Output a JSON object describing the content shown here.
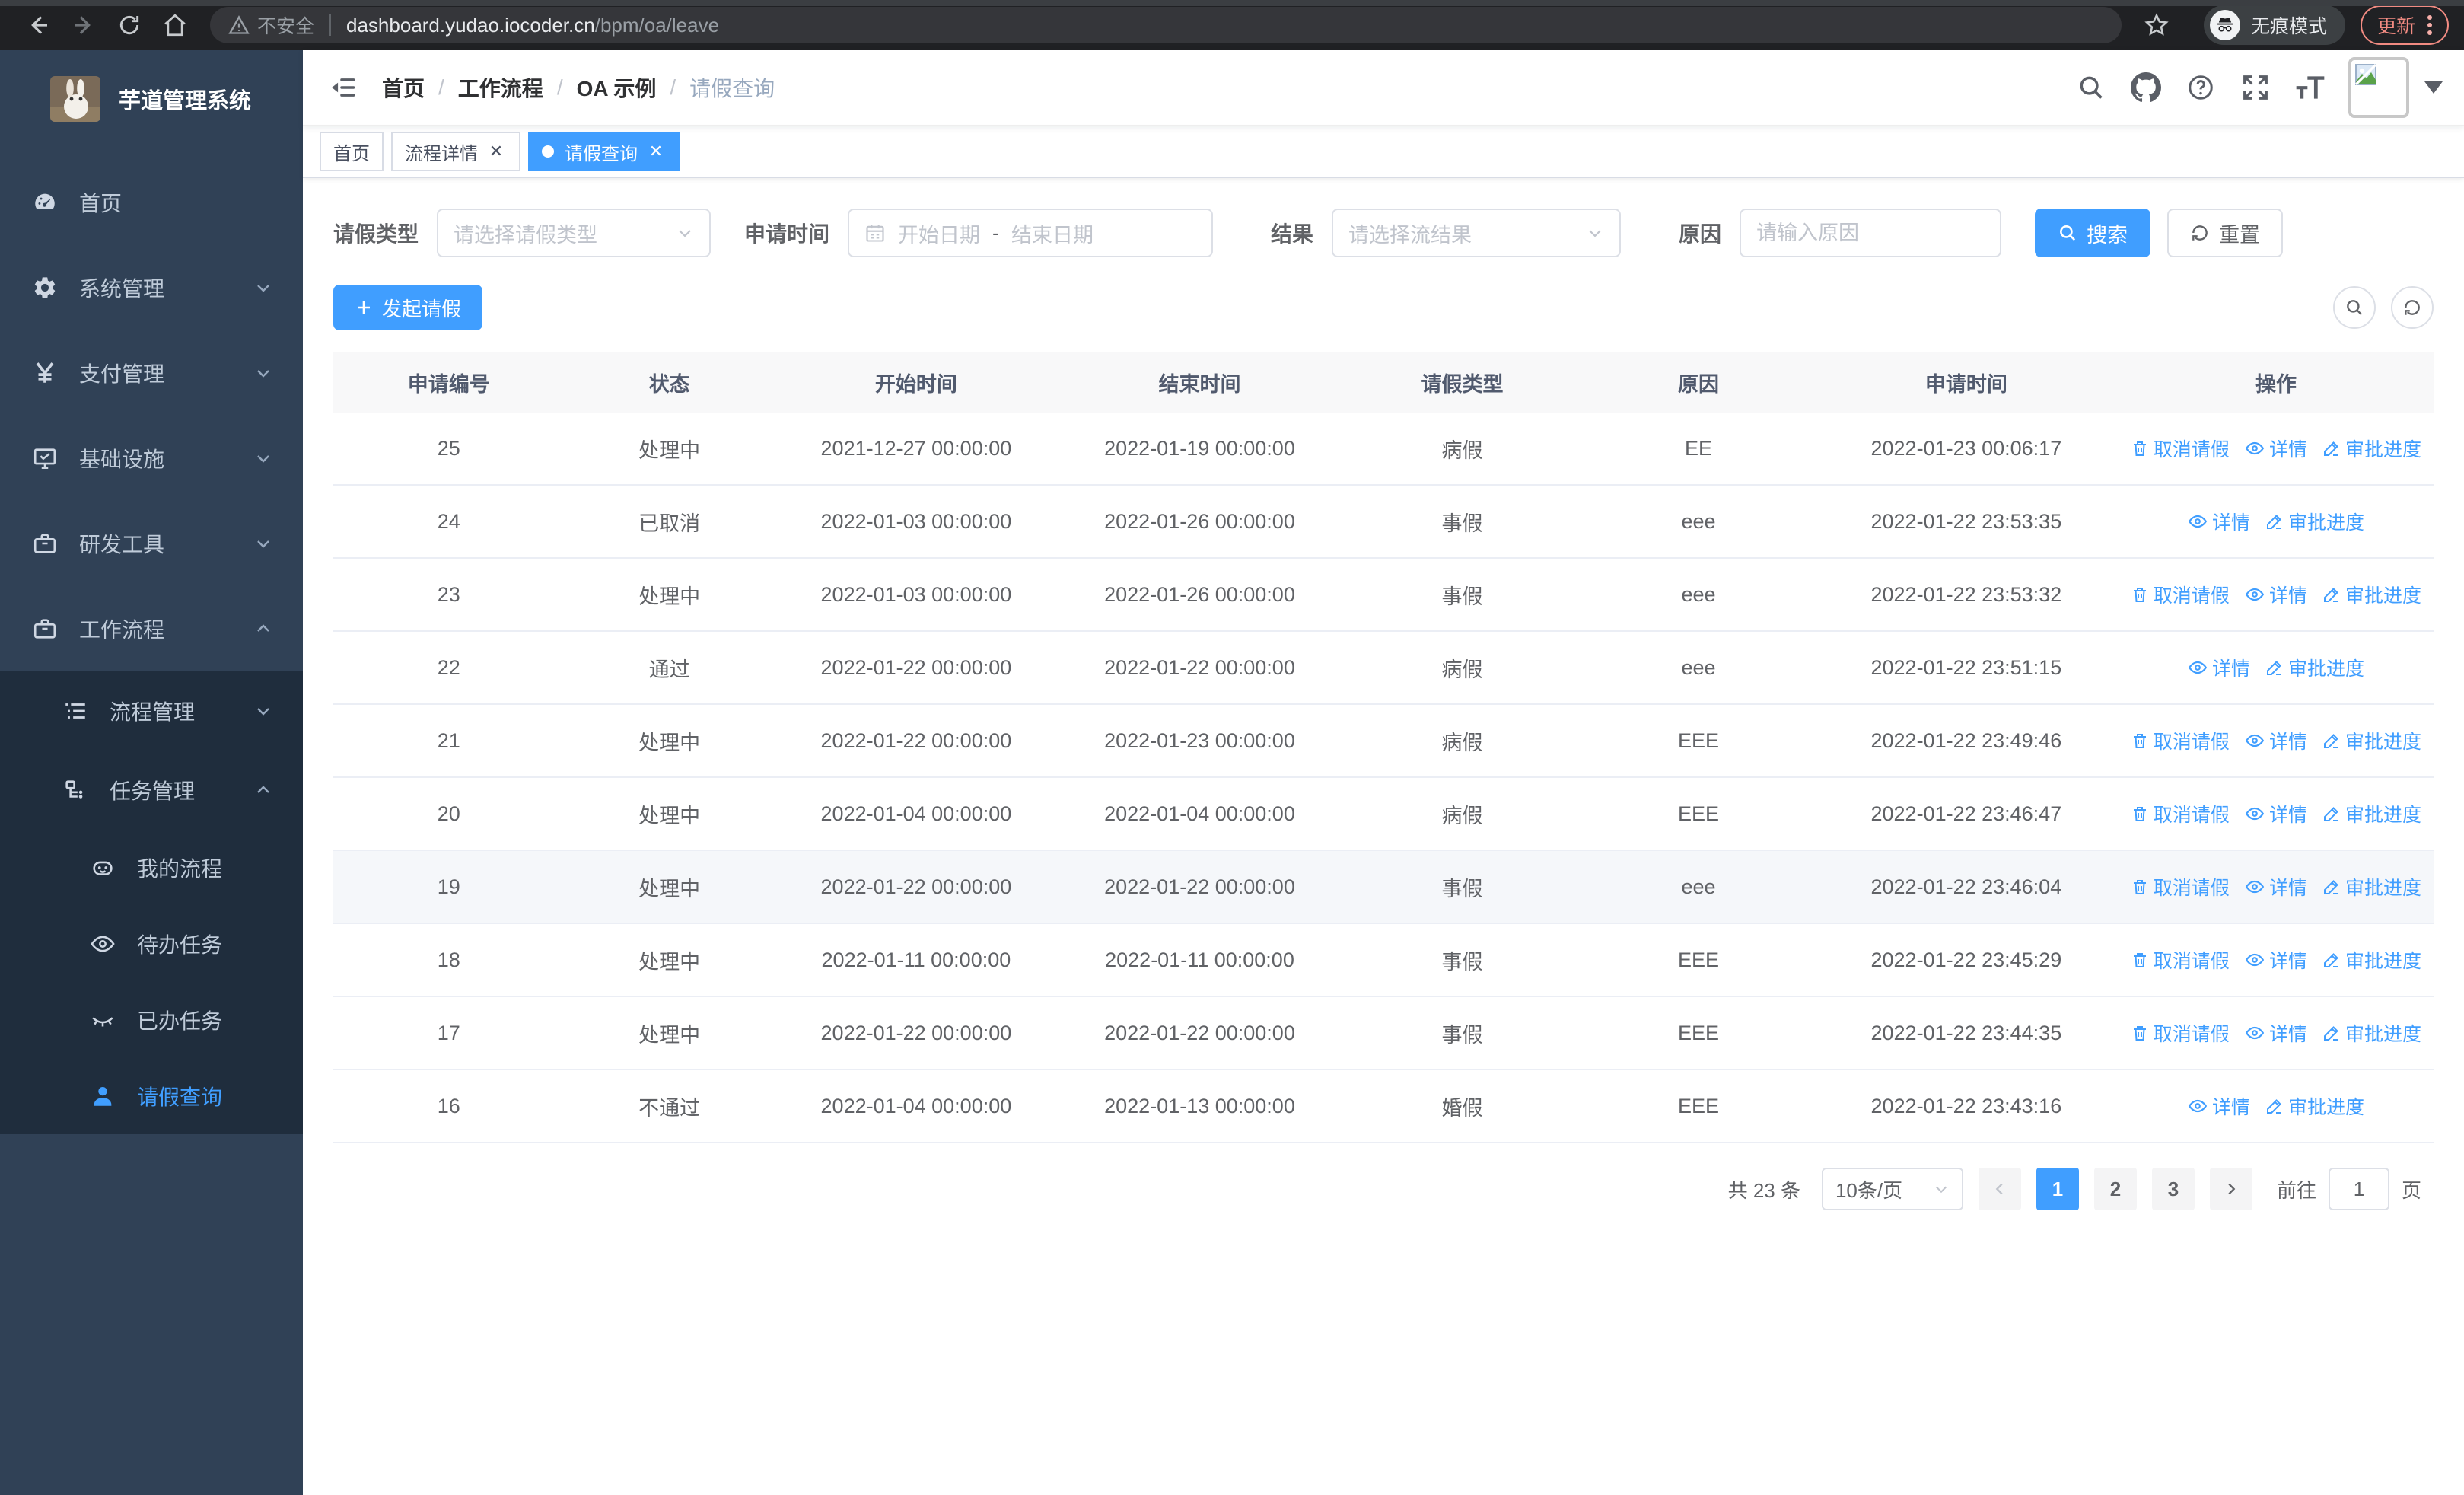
{
  "browser": {
    "security_label": "不安全",
    "url_host": "dashboard.yudao.iocoder.cn",
    "url_path": "/bpm/oa/leave",
    "incognito_label": "无痕模式",
    "update_label": "更新"
  },
  "sidebar": {
    "title": "芋道管理系统",
    "items": [
      {
        "label": "首页"
      },
      {
        "label": "系统管理"
      },
      {
        "label": "支付管理"
      },
      {
        "label": "基础设施"
      },
      {
        "label": "研发工具"
      },
      {
        "label": "工作流程"
      },
      {
        "label": "流程管理"
      },
      {
        "label": "任务管理"
      },
      {
        "label": "我的流程"
      },
      {
        "label": "待办任务"
      },
      {
        "label": "已办任务"
      },
      {
        "label": "请假查询"
      }
    ]
  },
  "breadcrumb": {
    "items": [
      "首页",
      "工作流程",
      "OA 示例",
      "请假查询"
    ]
  },
  "tabs": [
    {
      "label": "首页"
    },
    {
      "label": "流程详情"
    },
    {
      "label": "请假查询"
    }
  ],
  "filters": {
    "leave_type_label": "请假类型",
    "leave_type_placeholder": "请选择请假类型",
    "apply_time_label": "申请时间",
    "start_date_placeholder": "开始日期",
    "range_separator": "-",
    "end_date_placeholder": "结束日期",
    "result_label": "结果",
    "result_placeholder": "请选择流结果",
    "reason_label": "原因",
    "reason_placeholder": "请输入原因",
    "search_label": "搜索",
    "reset_label": "重置"
  },
  "toolbar": {
    "create_label": "发起请假"
  },
  "table": {
    "columns": [
      "申请编号",
      "状态",
      "开始时间",
      "结束时间",
      "请假类型",
      "原因",
      "申请时间",
      "操作"
    ],
    "actions": {
      "cancel": "取消请假",
      "detail": "详情",
      "progress": "审批进度"
    },
    "rows": [
      {
        "id": "25",
        "status": "处理中",
        "start": "2021-12-27 00:00:00",
        "end": "2022-01-19 00:00:00",
        "type": "病假",
        "reason": "EE",
        "applied": "2022-01-23 00:06:17",
        "can_cancel": true,
        "highlight": false
      },
      {
        "id": "24",
        "status": "已取消",
        "start": "2022-01-03 00:00:00",
        "end": "2022-01-26 00:00:00",
        "type": "事假",
        "reason": "eee",
        "applied": "2022-01-22 23:53:35",
        "can_cancel": false,
        "highlight": false
      },
      {
        "id": "23",
        "status": "处理中",
        "start": "2022-01-03 00:00:00",
        "end": "2022-01-26 00:00:00",
        "type": "事假",
        "reason": "eee",
        "applied": "2022-01-22 23:53:32",
        "can_cancel": true,
        "highlight": false
      },
      {
        "id": "22",
        "status": "通过",
        "start": "2022-01-22 00:00:00",
        "end": "2022-01-22 00:00:00",
        "type": "病假",
        "reason": "eee",
        "applied": "2022-01-22 23:51:15",
        "can_cancel": false,
        "highlight": false
      },
      {
        "id": "21",
        "status": "处理中",
        "start": "2022-01-22 00:00:00",
        "end": "2022-01-23 00:00:00",
        "type": "病假",
        "reason": "EEE",
        "applied": "2022-01-22 23:49:46",
        "can_cancel": true,
        "highlight": false
      },
      {
        "id": "20",
        "status": "处理中",
        "start": "2022-01-04 00:00:00",
        "end": "2022-01-04 00:00:00",
        "type": "病假",
        "reason": "EEE",
        "applied": "2022-01-22 23:46:47",
        "can_cancel": true,
        "highlight": false
      },
      {
        "id": "19",
        "status": "处理中",
        "start": "2022-01-22 00:00:00",
        "end": "2022-01-22 00:00:00",
        "type": "事假",
        "reason": "eee",
        "applied": "2022-01-22 23:46:04",
        "can_cancel": true,
        "highlight": true
      },
      {
        "id": "18",
        "status": "处理中",
        "start": "2022-01-11 00:00:00",
        "end": "2022-01-11 00:00:00",
        "type": "事假",
        "reason": "EEE",
        "applied": "2022-01-22 23:45:29",
        "can_cancel": true,
        "highlight": false
      },
      {
        "id": "17",
        "status": "处理中",
        "start": "2022-01-22 00:00:00",
        "end": "2022-01-22 00:00:00",
        "type": "事假",
        "reason": "EEE",
        "applied": "2022-01-22 23:44:35",
        "can_cancel": true,
        "highlight": false
      },
      {
        "id": "16",
        "status": "不通过",
        "start": "2022-01-04 00:00:00",
        "end": "2022-01-13 00:00:00",
        "type": "婚假",
        "reason": "EEE",
        "applied": "2022-01-22 23:43:16",
        "can_cancel": false,
        "highlight": false
      }
    ]
  },
  "pagination": {
    "total_label": "共 23 条",
    "page_size_label": "10条/页",
    "pages": [
      "1",
      "2",
      "3"
    ],
    "goto_label": "前往",
    "goto_value": "1",
    "page_unit": "页"
  },
  "colors": {
    "accent": "#409eff",
    "sidebar_bg": "#304156",
    "submenu_bg": "#1f2d3d",
    "update_accent": "#f28b82"
  }
}
